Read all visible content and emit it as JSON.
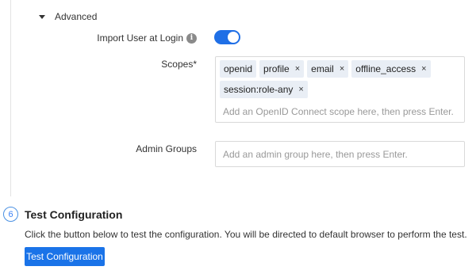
{
  "advanced": {
    "label": "Advanced",
    "import_user": {
      "label": "Import User at Login",
      "info_icon": "i",
      "enabled": true
    },
    "scopes": {
      "label": "Scopes*",
      "tags": [
        "openid",
        "profile",
        "email",
        "offline_access",
        "session:role-any"
      ],
      "removable": [
        false,
        true,
        true,
        true,
        true
      ],
      "remove_glyph": "×",
      "placeholder": "Add an OpenID Connect scope here, then press Enter."
    },
    "admin_groups": {
      "label": "Admin Groups",
      "placeholder": "Add an admin group here, then press Enter."
    }
  },
  "step6": {
    "number": "6",
    "title": "Test Configuration",
    "description": "Click the button below to test the configuration. You will be directed to default browser to perform the test.",
    "button_label": "Test Configuration"
  },
  "colors": {
    "accent": "#1a73e8",
    "toggle_on": "#1f6fe6",
    "tag_bg": "#e9eef5"
  }
}
